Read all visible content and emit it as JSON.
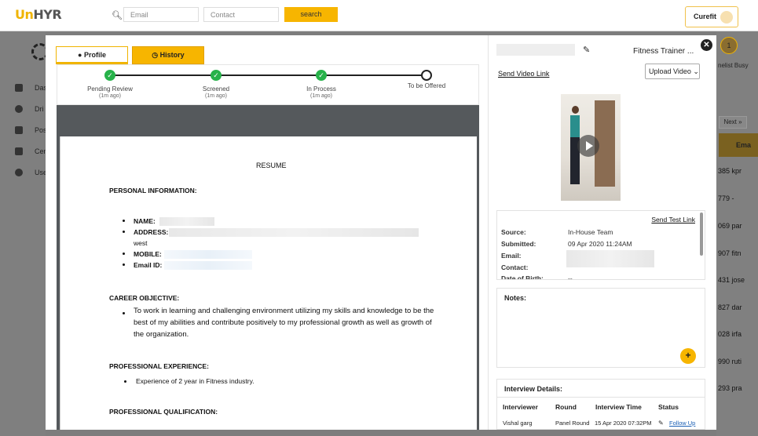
{
  "topbar": {
    "logo_prefix": "Un",
    "logo_suffix": "HYR",
    "email_placeholder": "Email",
    "contact_placeholder": "Contact",
    "search_label": "search",
    "account_name": "Curefit"
  },
  "background": {
    "sidebar_items": [
      "Das",
      "Dri",
      "Pos",
      "Cen",
      "Use"
    ],
    "right_partial": {
      "badge": "1",
      "status_text": "nelist Busy",
      "next_label": "Next »",
      "column": "Ema",
      "rows": [
        "385 kpr",
        "779 -",
        "069 par",
        "907 fitn",
        "431 jose",
        "827 dar",
        "028 irfa",
        "990 ruti",
        "293 pra"
      ]
    }
  },
  "modal": {
    "tabs": {
      "profile": "Profile",
      "history": "History"
    },
    "stepper": [
      {
        "label": "Pending Review",
        "time": "(1m ago)",
        "done": true
      },
      {
        "label": "Screened",
        "time": "(1m ago)",
        "done": true
      },
      {
        "label": "In Process",
        "time": "(1m ago)",
        "done": true
      },
      {
        "label": "To be Offered",
        "time": "",
        "done": false
      }
    ],
    "resume": {
      "title": "RESUME",
      "personal_heading": "PERSONAL INFORMATION:",
      "name_label": "NAME:",
      "address_label": "ADDRESS:",
      "address_tail": "west",
      "mobile_label": "MOBILE:",
      "email_label": "Email ID:",
      "career_heading": "CAREER OBJECTIVE:",
      "career_text": "To work in learning and challenging environment utilizing my skills and knowledge to be the best of my abilities and contribute positively to my professional growth as well as growth of the organization.",
      "experience_heading": "PROFESSIONAL EXPERIENCE:",
      "experience_item": "Experience of 2 year in Fitness industry.",
      "qualification_heading": "PROFESSIONAL QUALIFICATION:"
    },
    "right": {
      "role": "Fitness Trainer ...",
      "send_video_link": "Send Video Link",
      "upload_video": "Upload Video",
      "send_test_link": "Send Test Link",
      "info": [
        {
          "key": "Source:",
          "value": "In-House Team"
        },
        {
          "key": "Submitted:",
          "value": "09 Apr 2020 11:24AM"
        },
        {
          "key": "Email:",
          "value": ""
        },
        {
          "key": "Contact:",
          "value": ""
        },
        {
          "key": "Date of Birth:",
          "value": "--"
        }
      ],
      "notes_label": "Notes:",
      "add_label": "+",
      "interview_heading": "Interview Details:",
      "interview_columns": [
        "Interviewer",
        "Round",
        "Interview Time",
        "Status"
      ],
      "interview_row": {
        "interviewer": "Vishal garg",
        "round": "Panel Round",
        "time": "15 Apr 2020 07:32PM",
        "status": "Follow Up"
      }
    }
  }
}
